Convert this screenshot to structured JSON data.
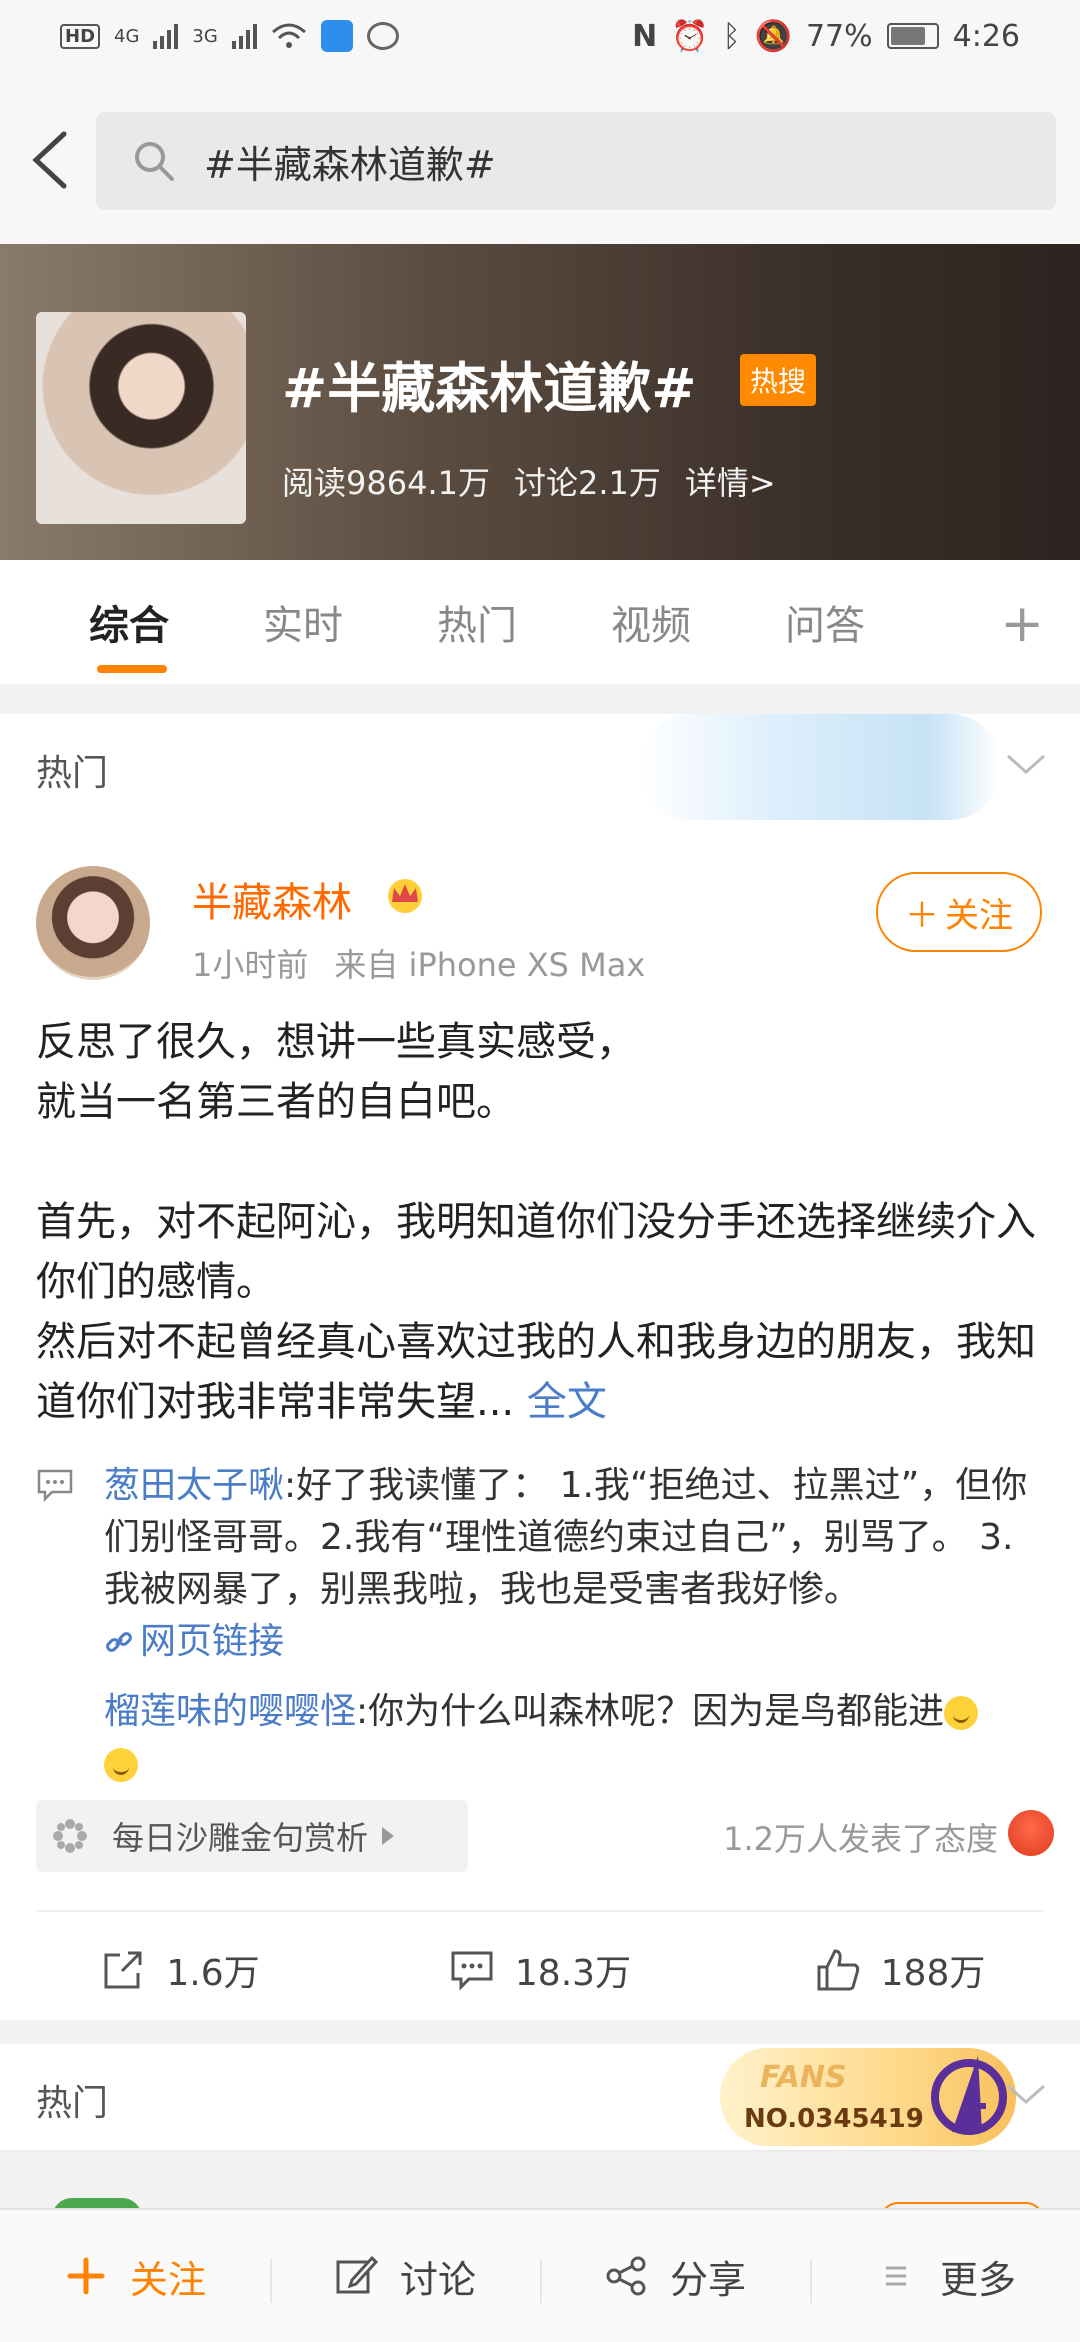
{
  "status_bar": {
    "battery": "77%",
    "time": "4:26",
    "net1": "4G",
    "net2": "3G",
    "hd": "HD"
  },
  "search": {
    "query": "#半藏森林道歉#"
  },
  "topic": {
    "title": "#半藏森林道歉#",
    "badge": "热搜",
    "reads": "阅读9864.1万",
    "discussions": "讨论2.1万",
    "details": "详情>"
  },
  "tabs": [
    "综合",
    "实时",
    "热门",
    "视频",
    "问答"
  ],
  "sections": {
    "hot1": "热门",
    "hot2": "热门"
  },
  "post": {
    "author": "半藏森林",
    "time": "1小时前",
    "source": "来自 iPhone XS Max",
    "follow": "关注",
    "lines": [
      "反思了很久，想讲一些真实感受，",
      "就当一名第三者的自白吧。",
      "首先，对不起阿沁，我明知道你们没分手还选择继续介入你们的感情。",
      "然后对不起曾经真心喜欢过我的人和我身边的朋友，我知道你们对我非常非常失望..."
    ],
    "read_more": "全文",
    "comments": [
      {
        "user": "葱田太子啾",
        "text": ":好了我读懂了： 1.我“拒绝过、拉黑过”，但你们别怪哥哥。2.我有“理性道德约束过自己”，别骂了。 3.我被网暴了，别黑我啦，我也是受害者我好惨。",
        "link": "网页链接"
      },
      {
        "user": "榴莲味的嘤嘤怪",
        "text": ":你为什么叫森林呢？因为是鸟都能进"
      }
    ],
    "supertopic": "每日沙雕金句赏析",
    "attitude": "1.2万人发表了态度",
    "repost": "1.6万",
    "comment_count": "18.3万",
    "likes": "188万"
  },
  "fans_badge": {
    "label": "FANS",
    "number": "NO.0345419"
  },
  "bottom_bar": {
    "follow": "关注",
    "discuss": "讨论",
    "share": "分享",
    "more": "更多"
  },
  "colors": {
    "accent": "#ff8200",
    "link": "#4a7cc7",
    "hot_badge": "#ff8a00"
  }
}
